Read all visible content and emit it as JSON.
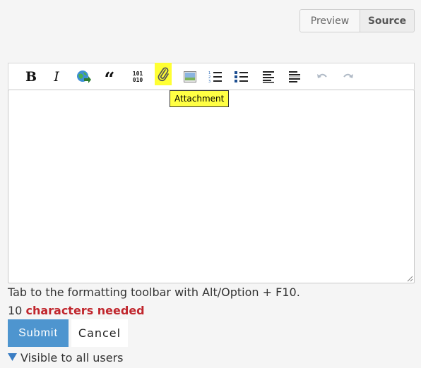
{
  "view_toggle": {
    "preview_label": "Preview",
    "source_label": "Source",
    "active": "Source"
  },
  "toolbar": {
    "bold_glyph": "B",
    "italic_glyph": "I",
    "quote_glyph": "“",
    "code_line1": "101",
    "code_line2": "010",
    "tooltip": "Attachment"
  },
  "editor": {
    "value": ""
  },
  "hint": "Tab to the formatting toolbar with Alt/Option + F10.",
  "counter": {
    "count": "10",
    "message": "characters needed"
  },
  "buttons": {
    "submit": "Submit",
    "cancel": "Cancel"
  },
  "visibility": {
    "label": "Visible to all users"
  },
  "colors": {
    "submit_bg": "#4e95cf",
    "highlight": "#ffff33",
    "needed_text": "#c0262d"
  }
}
